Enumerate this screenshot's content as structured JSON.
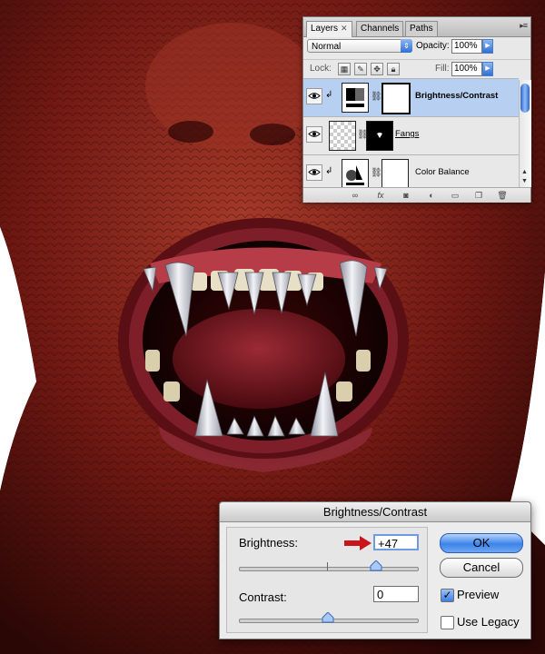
{
  "layers_panel": {
    "tabs": [
      "Layers",
      "Channels",
      "Paths"
    ],
    "blend_mode": "Normal",
    "opacity_label": "Opacity:",
    "opacity_value": "100%",
    "lock_label": "Lock:",
    "fill_label": "Fill:",
    "fill_value": "100%",
    "layers": [
      {
        "name": "Brightness/Contrast",
        "selected": true
      },
      {
        "name": "Fangs",
        "selected": false
      },
      {
        "name": "Color Balance",
        "selected": false
      }
    ]
  },
  "dialog": {
    "title": "Brightness/Contrast",
    "brightness_label": "Brightness:",
    "brightness_value": "+47",
    "brightness_level": 47,
    "contrast_label": "Contrast:",
    "contrast_value": "0",
    "contrast_level": 0,
    "ok_label": "OK",
    "cancel_label": "Cancel",
    "preview_label": "Preview",
    "preview_checked": true,
    "legacy_label": "Use Legacy",
    "legacy_checked": false
  },
  "colors": {
    "skin": "#7a1a14",
    "selection": "#b7d0f2",
    "accent_blue": "#3b83ea",
    "arrow_red": "#c8141b"
  }
}
